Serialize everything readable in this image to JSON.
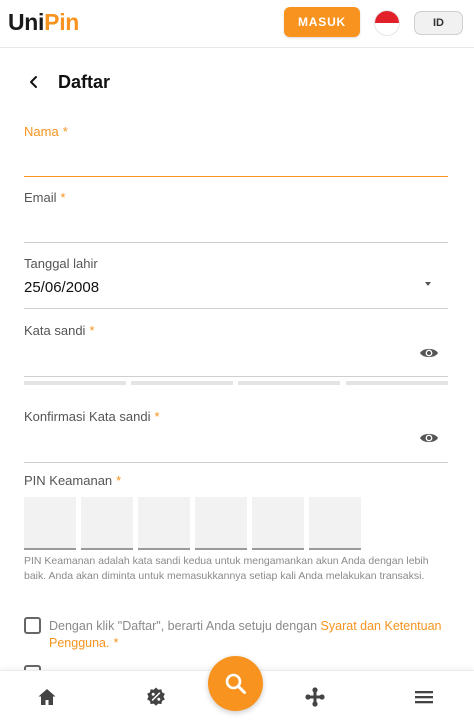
{
  "header": {
    "logo_uni": "Uni",
    "logo_pin": "Pin",
    "login_label": "MASUK",
    "language_label": "ID",
    "flag_icon": "indonesia-flag-icon"
  },
  "page": {
    "title": "Daftar",
    "back_icon": "chevron-left-icon"
  },
  "form": {
    "name": {
      "label": "Nama",
      "required_mark": "*",
      "value": ""
    },
    "email": {
      "label": "Email",
      "required_mark": "*",
      "value": ""
    },
    "birth_date": {
      "label": "Tanggal lahir",
      "value": "25/06/2008",
      "dropdown_icon": "caret-down-icon"
    },
    "password": {
      "label": "Kata sandi",
      "required_mark": "*",
      "value": "",
      "toggle_icon": "eye-icon"
    },
    "password_confirm": {
      "label": "Konfirmasi Kata sandi",
      "required_mark": "*",
      "value": "",
      "toggle_icon": "eye-icon"
    },
    "security_pin": {
      "label": "PIN Keamanan",
      "required_mark": "*",
      "digits": [
        "",
        "",
        "",
        "",
        "",
        ""
      ],
      "helper": "PIN Keamanan adalah kata sandi kedua untuk mengamankan akun Anda dengan lebih baik. Anda akan diminta untuk memasukkannya setiap kali Anda melakukan transaksi."
    },
    "terms": {
      "text_before": "Dengan klik \"Daftar\", berarti Anda setuju dengan ",
      "link": "Syarat dan Ketentuan Pengguna.",
      "required_mark": "*",
      "checked": false
    }
  },
  "bottom_nav": {
    "items": [
      {
        "icon": "home-icon"
      },
      {
        "icon": "promo-badge-icon"
      },
      {
        "icon": "search-icon"
      },
      {
        "icon": "gamepad-icon"
      },
      {
        "icon": "menu-icon"
      }
    ]
  },
  "colors": {
    "accent": "#f7931e",
    "flag_red": "#e2202a",
    "text": "#222222",
    "muted": "#8a8a8a"
  }
}
